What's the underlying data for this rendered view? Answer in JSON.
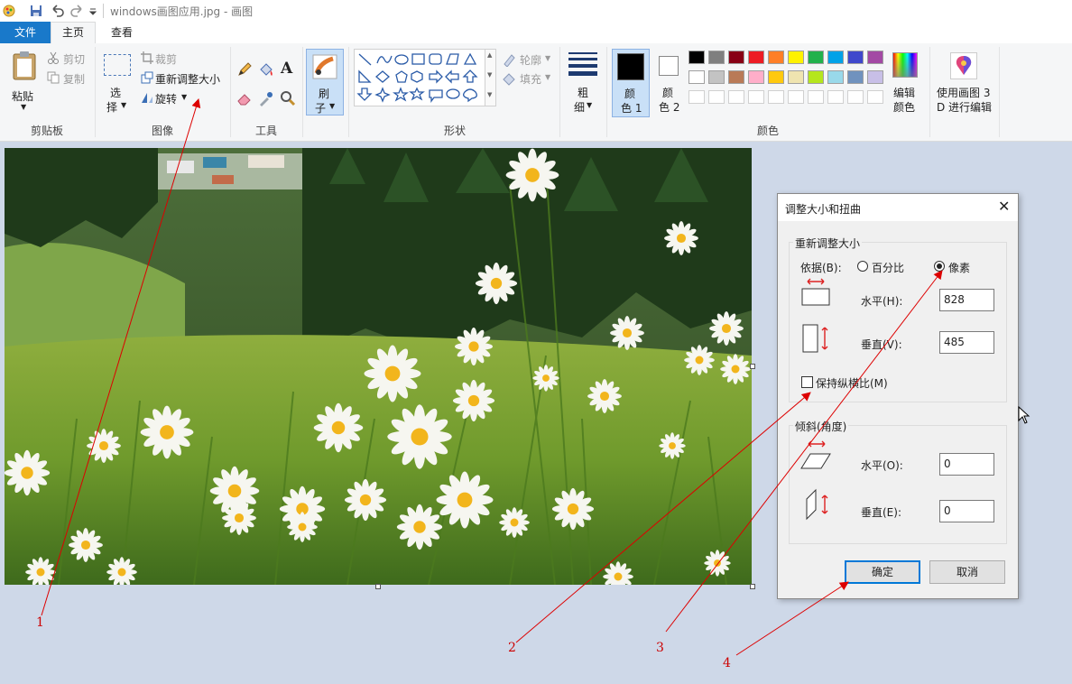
{
  "window": {
    "title": "windows画图应用.jpg - 画图"
  },
  "tabs": {
    "file": "文件",
    "home": "主页",
    "view": "查看"
  },
  "clipboard": {
    "paste": "粘贴",
    "cut": "剪切",
    "copy": "复制",
    "group": "剪贴板"
  },
  "image": {
    "select_top": "选",
    "select_bottom": "择",
    "crop": "裁剪",
    "resize": "重新调整大小",
    "rotate": "旋转",
    "group": "图像"
  },
  "tools": {
    "group": "工具"
  },
  "brushes": {
    "label_top": "刷",
    "label_bottom": "子"
  },
  "shapes": {
    "outline": "轮廓",
    "fill": "填充",
    "group": "形状"
  },
  "size": {
    "top": "粗",
    "bottom": "细"
  },
  "colors": {
    "color1_top": "颜",
    "color1_bottom": "色 1",
    "color2_top": "颜",
    "color2_bottom": "色 2",
    "edit_top": "编辑",
    "edit_bottom": "颜色",
    "group": "颜色",
    "row1": [
      "#000000",
      "#7f7f7f",
      "#880015",
      "#ed1c24",
      "#ff7f27",
      "#fff200",
      "#22b14c",
      "#00a2e8",
      "#3f48cc",
      "#a349a4"
    ],
    "row2": [
      "#ffffff",
      "#c3c3c3",
      "#b97a57",
      "#ffaec9",
      "#ffc90e",
      "#efe4b0",
      "#b5e61d",
      "#99d9ea",
      "#7092be",
      "#c8bfe7"
    ],
    "row3": [
      "#ffffff",
      "#ffffff",
      "#ffffff",
      "#ffffff",
      "#ffffff",
      "#ffffff",
      "#ffffff",
      "#ffffff",
      "#ffffff",
      "#ffffff"
    ]
  },
  "paint3d": {
    "top": "使用画图 3",
    "bottom": "D 进行编辑"
  },
  "dialog": {
    "title": "调整大小和扭曲",
    "resize_legend": "重新调整大小",
    "by_label": "依据(B):",
    "percent": "百分比",
    "pixels": "像素",
    "horizontal_label": "水平(H):",
    "horizontal_value": "828",
    "vertical_label": "垂直(V):",
    "vertical_value": "485",
    "keep_ratio": "保持纵横比(M)",
    "skew_legend": "倾斜(角度)",
    "skew_h_label": "水平(O):",
    "skew_h_value": "0",
    "skew_v_label": "垂直(E):",
    "skew_v_value": "0",
    "ok": "确定",
    "cancel": "取消"
  },
  "annotations": [
    "1",
    "2",
    "3",
    "4"
  ]
}
